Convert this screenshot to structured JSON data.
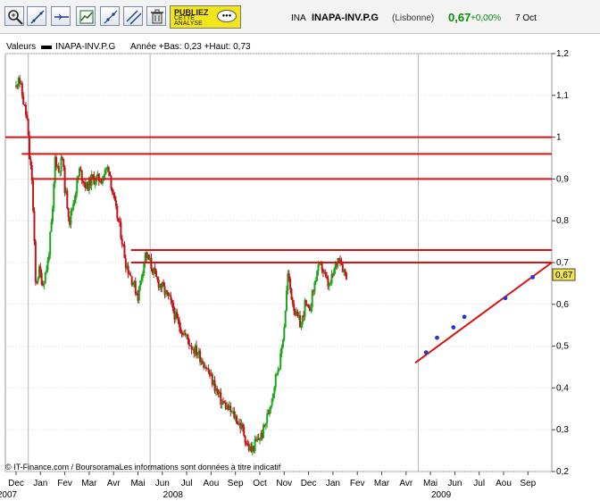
{
  "toolbar": {
    "buttons": [
      {
        "icon": "zoom-icon"
      },
      {
        "icon": "trendline-icon"
      },
      {
        "icon": "horizontal-line-icon"
      },
      {
        "icon": "indicator-icon"
      },
      {
        "icon": "fibonacci-icon"
      },
      {
        "icon": "parallel-lines-icon"
      },
      {
        "icon": "trash-icon"
      }
    ],
    "publish_line1": "PUBLIEZ",
    "publish_line2": "CETTE\nANALYSE"
  },
  "quote": {
    "market": "INA",
    "name": "INAPA-INV.P.G",
    "exchange": "(Lisbonne)",
    "price": "0,67",
    "change": "+0,00%",
    "date": "7 Oct"
  },
  "legend": {
    "prefix": "Valeurs",
    "series": "INAPA-INV.P.G",
    "info": "Année +Bas: 0,23 +Haut: 0,73"
  },
  "copyright": "© IT-Finance.com / BoursoramaLes informations sont données à titre indicatif",
  "colors": {
    "up": "#1aa61a",
    "down": "#c0141a",
    "line": "#dd1010",
    "trend": "#dd1010",
    "dots": "#2a36c8",
    "grid": "#dcdcdc",
    "price_tag": "#f0e54a"
  },
  "chart_data": {
    "type": "candlestick",
    "y_axis": {
      "min": 0.2,
      "max": 1.2,
      "ticks": [
        "0,2",
        "0,3",
        "0,4",
        "0,5",
        "0,6",
        "0,7",
        "0,8",
        "0,9",
        "1",
        "1,1",
        "1,2"
      ],
      "position": "right"
    },
    "x_axis": {
      "months": [
        "Dec",
        "Jan",
        "Fev",
        "Mar",
        "Avr",
        "Mai",
        "Jun",
        "Jul",
        "Aou",
        "Sep",
        "Oct",
        "Nov",
        "Dec",
        "Jan",
        "Fev",
        "Mar",
        "Avr",
        "Mai",
        "Jun",
        "Jul",
        "Aou",
        "Sep"
      ],
      "years": [
        {
          "label": "2007",
          "month_index": 0
        },
        {
          "label": "2008",
          "month_index": 6
        },
        {
          "label": "2009",
          "month_index": 17
        }
      ]
    },
    "last_price_label": "0,67",
    "last_price": 0.67,
    "price_path": [
      [
        0,
        1.12
      ],
      [
        0.1,
        1.15
      ],
      [
        0.25,
        1.1
      ],
      [
        0.45,
        1.04
      ],
      [
        0.55,
        0.95
      ],
      [
        0.65,
        0.9
      ],
      [
        0.75,
        0.74
      ],
      [
        0.8,
        0.65
      ],
      [
        0.95,
        0.68
      ],
      [
        1.1,
        0.65
      ],
      [
        1.3,
        0.7
      ],
      [
        1.5,
        0.82
      ],
      [
        1.6,
        0.95
      ],
      [
        1.75,
        0.92
      ],
      [
        1.9,
        0.95
      ],
      [
        2.0,
        0.88
      ],
      [
        2.2,
        0.8
      ],
      [
        2.4,
        0.86
      ],
      [
        2.6,
        0.92
      ],
      [
        2.9,
        0.88
      ],
      [
        3.1,
        0.9
      ],
      [
        3.5,
        0.9
      ],
      [
        3.8,
        0.93
      ],
      [
        4.0,
        0.85
      ],
      [
        4.3,
        0.77
      ],
      [
        4.5,
        0.7
      ],
      [
        4.75,
        0.66
      ],
      [
        5.0,
        0.62
      ],
      [
        5.15,
        0.67
      ],
      [
        5.3,
        0.72
      ],
      [
        5.5,
        0.7
      ],
      [
        5.75,
        0.66
      ],
      [
        6.0,
        0.64
      ],
      [
        6.3,
        0.61
      ],
      [
        6.6,
        0.56
      ],
      [
        6.9,
        0.53
      ],
      [
        7.2,
        0.5
      ],
      [
        7.5,
        0.48
      ],
      [
        7.8,
        0.45
      ],
      [
        8.1,
        0.41
      ],
      [
        8.4,
        0.37
      ],
      [
        8.7,
        0.35
      ],
      [
        9.0,
        0.33
      ],
      [
        9.3,
        0.3
      ],
      [
        9.5,
        0.26
      ],
      [
        9.65,
        0.25
      ],
      [
        9.85,
        0.27
      ],
      [
        10.1,
        0.29
      ],
      [
        10.3,
        0.33
      ],
      [
        10.5,
        0.38
      ],
      [
        10.7,
        0.44
      ],
      [
        10.85,
        0.47
      ],
      [
        11.0,
        0.55
      ],
      [
        11.15,
        0.67
      ],
      [
        11.3,
        0.62
      ],
      [
        11.5,
        0.57
      ],
      [
        11.7,
        0.55
      ],
      [
        11.85,
        0.6
      ],
      [
        12.0,
        0.58
      ],
      [
        12.15,
        0.62
      ],
      [
        12.35,
        0.68
      ],
      [
        12.55,
        0.69
      ],
      [
        12.7,
        0.66
      ],
      [
        12.85,
        0.64
      ],
      [
        13.05,
        0.68
      ],
      [
        13.25,
        0.72
      ],
      [
        13.45,
        0.68
      ],
      [
        13.6,
        0.67
      ]
    ],
    "levels": [
      {
        "value": 1.0,
        "from": 0.0
      },
      {
        "value": 0.96,
        "from": 0.03
      },
      {
        "value": 0.9,
        "from": 0.05
      },
      {
        "value": 0.73,
        "from": 0.23
      },
      {
        "value": 0.7,
        "from": 0.23
      }
    ],
    "trendline": {
      "from": [
        0.75,
        0.46
      ],
      "to": [
        1.0,
        0.7
      ]
    },
    "touch_points": [
      [
        0.77,
        0.485
      ],
      [
        0.79,
        0.52
      ],
      [
        0.82,
        0.545
      ],
      [
        0.84,
        0.57
      ],
      [
        0.915,
        0.615
      ],
      [
        0.965,
        0.665
      ]
    ]
  }
}
